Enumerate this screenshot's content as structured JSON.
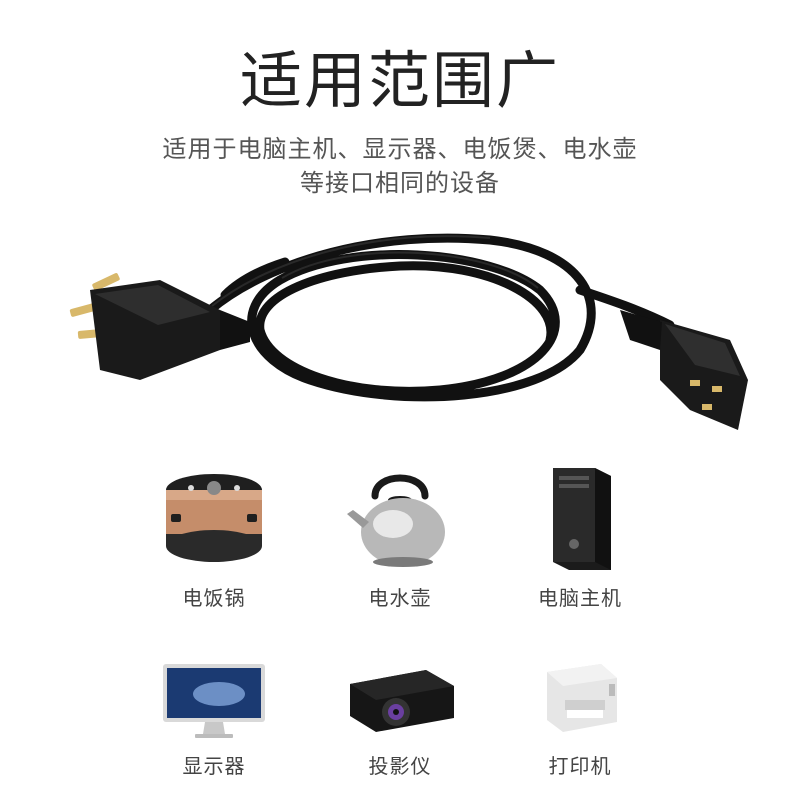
{
  "header": {
    "title": "适用范围广",
    "subtitle_line1": "适用于电脑主机、显示器、电饭煲、电水壶",
    "subtitle_line2": "等接口相同的设备"
  },
  "hero": {
    "image": "power-cord"
  },
  "appliances": [
    {
      "label": "电饭锅",
      "icon": "rice-cooker-icon"
    },
    {
      "label": "电水壶",
      "icon": "kettle-icon"
    },
    {
      "label": "电脑主机",
      "icon": "pc-tower-icon"
    },
    {
      "label": "显示器",
      "icon": "monitor-icon"
    },
    {
      "label": "投影仪",
      "icon": "projector-icon"
    },
    {
      "label": "打印机",
      "icon": "printer-icon"
    }
  ],
  "colors": {
    "title": "#222222",
    "subtitle": "#555555",
    "label": "#444444",
    "cable": "#111111"
  }
}
